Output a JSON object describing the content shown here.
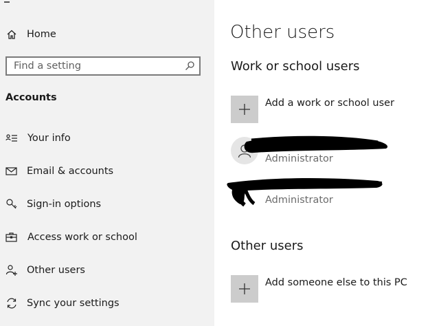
{
  "sidebar": {
    "home_label": "Home",
    "search": {
      "placeholder": "Find a setting",
      "icon": "search-icon"
    },
    "section_title": "Accounts",
    "items": [
      {
        "label": "Your info",
        "icon": "person-card-icon"
      },
      {
        "label": "Email & accounts",
        "icon": "envelope-icon"
      },
      {
        "label": "Sign-in options",
        "icon": "key-icon"
      },
      {
        "label": "Access work or school",
        "icon": "briefcase-icon"
      },
      {
        "label": "Other users",
        "icon": "person-add-icon"
      },
      {
        "label": "Sync your settings",
        "icon": "sync-icon"
      }
    ]
  },
  "main": {
    "title": "Other users",
    "work_section": {
      "heading": "Work or school users",
      "add_label": "Add a work or school user",
      "users": [
        {
          "role": "Administrator",
          "has_avatar": true
        },
        {
          "role": "Administrator",
          "has_avatar": false
        }
      ]
    },
    "other_section": {
      "heading": "Other users",
      "add_label": "Add someone else to this PC"
    }
  },
  "colors": {
    "sidebar_bg": "#f2f2f2",
    "tile_bg": "#cccccc",
    "secondary_text": "#6b6b6b",
    "redaction": "#000000"
  }
}
